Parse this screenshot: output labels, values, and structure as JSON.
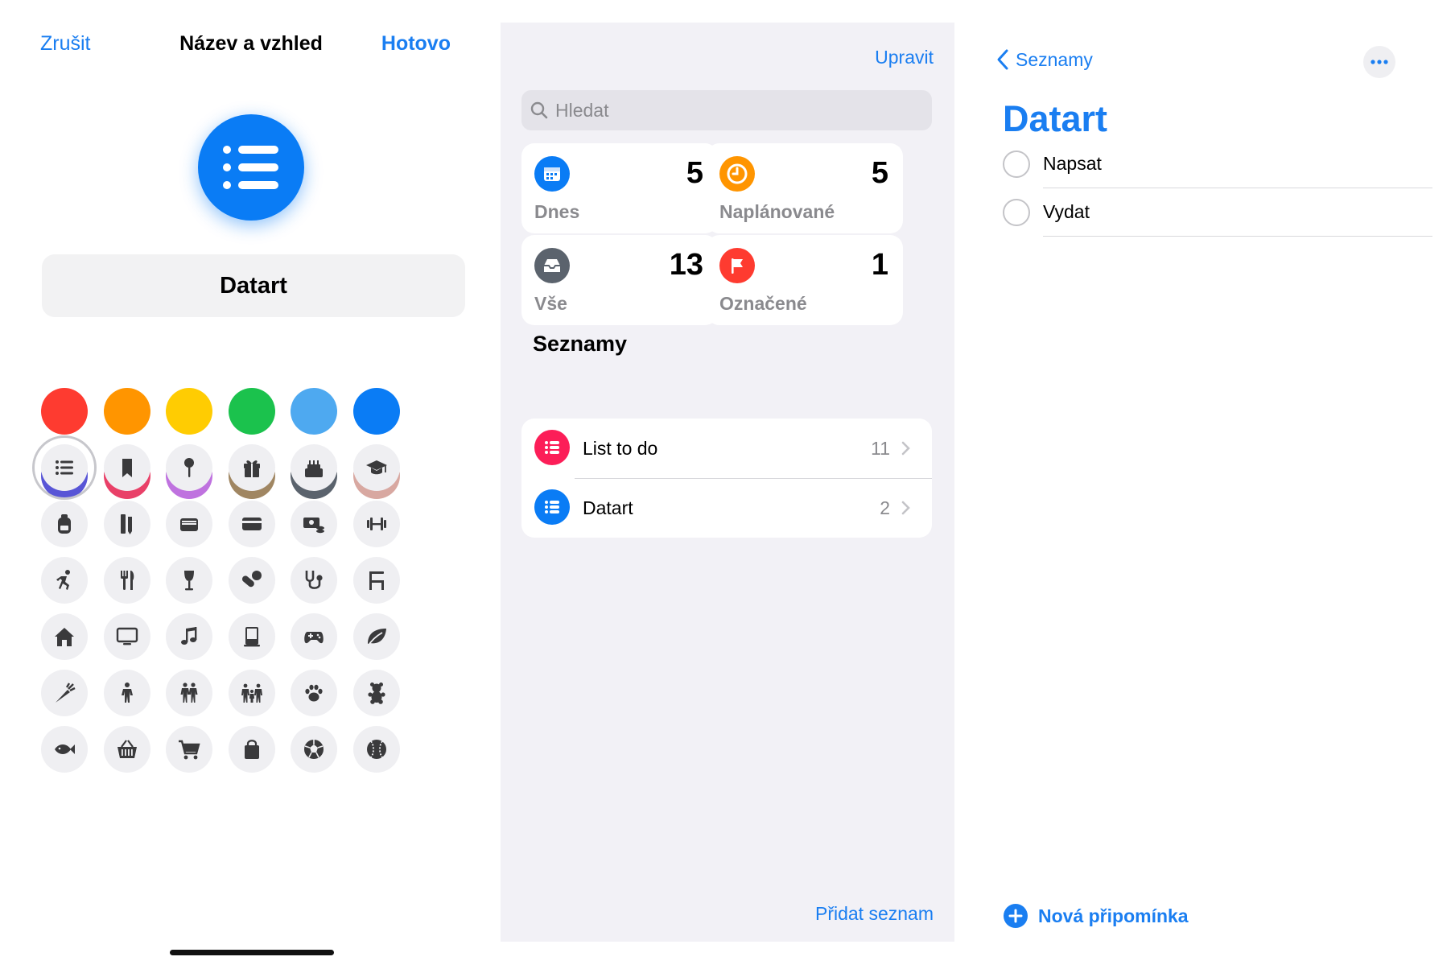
{
  "panel_appearance": {
    "nav": {
      "cancel": "Zrušit",
      "title": "Název a vzhled",
      "done": "Hotovo"
    },
    "list_name_value": "Datart",
    "selected_color": "#0a7cf5",
    "colors": [
      "#fe3b30",
      "#ff9500",
      "#ffcc02",
      "#1bc24d",
      "#4ea9f0",
      "#0a7cf5",
      "#5855d6",
      "#e94068",
      "#bf72df",
      "#a08662",
      "#5b636d",
      "#d8a8a1"
    ],
    "icons": [
      "list-icon",
      "bookmark-icon",
      "pushpin-icon",
      "gift-icon",
      "birthday-cake-icon",
      "graduation-cap-icon",
      "backpack-icon",
      "ruler-pencil-icon",
      "wallet-icon",
      "credit-card-icon",
      "money-icon",
      "dumbbell-icon",
      "running-icon",
      "fork-knife-icon",
      "wine-glass-icon",
      "pills-icon",
      "stethoscope-icon",
      "chair-icon",
      "house-icon",
      "tv-icon",
      "music-note-icon",
      "computer-icon",
      "gamepad-icon",
      "leaf-icon",
      "carrot-icon",
      "person-icon",
      "two-people-icon",
      "family-icon",
      "paw-icon",
      "teddy-bear-icon",
      "fish-icon",
      "basket-icon",
      "shopping-cart-icon",
      "shopping-bag-icon",
      "soccer-ball-icon",
      "baseball-icon"
    ],
    "selected_icon": "list-icon"
  },
  "panel_overview": {
    "edit": "Upravit",
    "search_placeholder": "Hledat",
    "smart_lists": [
      {
        "label": "Dnes",
        "count": "5",
        "color": "#0a7cf5",
        "icon": "calendar-icon"
      },
      {
        "label": "Naplánované",
        "count": "5",
        "color": "#ff9500",
        "icon": "clock-icon"
      },
      {
        "label": "Vše",
        "count": "13",
        "color": "#5b636d",
        "icon": "tray-icon"
      },
      {
        "label": "Označené",
        "count": "1",
        "color": "#fe3b30",
        "icon": "flag-icon"
      }
    ],
    "section_title": "Seznamy",
    "lists": [
      {
        "name": "List to do",
        "count": "11",
        "color": "#fc1e58"
      },
      {
        "name": "Datart",
        "count": "2",
        "color": "#0a7cf5"
      }
    ],
    "add_list": "Přidat seznam"
  },
  "panel_list": {
    "back_label": "Seznamy",
    "title": "Datart",
    "reminders": [
      "Napsat",
      "Vydat"
    ],
    "new_reminder": "Nová připomínka"
  }
}
